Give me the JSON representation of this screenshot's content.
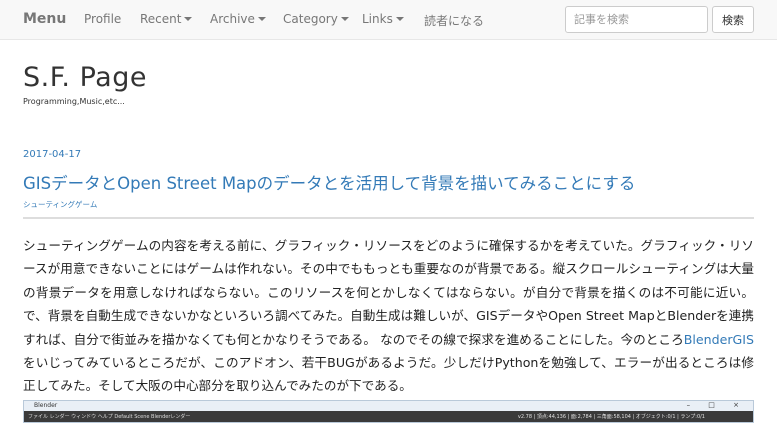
{
  "navbar": {
    "brand": "Menu",
    "items": [
      {
        "label": "Profile",
        "dropdown": false
      },
      {
        "label": "Recent",
        "dropdown": true
      },
      {
        "label": "Archive",
        "dropdown": true
      },
      {
        "label": "Category",
        "dropdown": true
      },
      {
        "label": "Links",
        "dropdown": true
      },
      {
        "label": "読者になる",
        "dropdown": false
      }
    ],
    "search": {
      "placeholder": "記事を検索",
      "button_label": "検索"
    }
  },
  "site": {
    "title": "S.F. Page",
    "tagline": "Programming,Music,etc..."
  },
  "post": {
    "date": "2017-04-17",
    "title": "GISデータとOpen Street Mapのデータとを活用して背景を描いてみることにする",
    "category": "シューティングゲーム",
    "body_before_link": "シューティングゲームの内容を考える前に、グラフィック・リソースをどのように確保するかを考えていた。グラフィック・リソースが用意できないことにはゲームは作れない。その中でももっとも重要なのが背景である。縦スクロールシューティングは大量の背景データを用意しなければならない。このリソースを何とかしなくてはならない。が自分で背景を描くのは不可能に近い。 で、背景を自動生成できないかなといろいろ調べてみた。自動生成は難しいが、GISデータやOpen Street MapとBlenderを連携すれば、自分で街並みを描かなくても何とかなりそうである。 なのでその線で探求を進めることにした。今のところ",
    "link_text": "BlenderGIS",
    "body_after_link": "をいじってみているところだが、このアドオン、若干BUGがあるようだ。少しだけPythonを勉強して、エラーが出るところは修正してみた。そして大阪の中心部分を取り込んでみたのが下である。"
  },
  "embedded_screenshot": {
    "title": "Blender",
    "controls": "– □ ×",
    "toolbar": "ファイル  レンダー  ウィンドウ  ヘルプ   Default        Scene        Blenderレンダー",
    "status": "v2.78 | 頂点:44,136 | 面:2,784 | 三角面:58,104 | オブジェクト:0/1 | ランプ:0/1"
  }
}
